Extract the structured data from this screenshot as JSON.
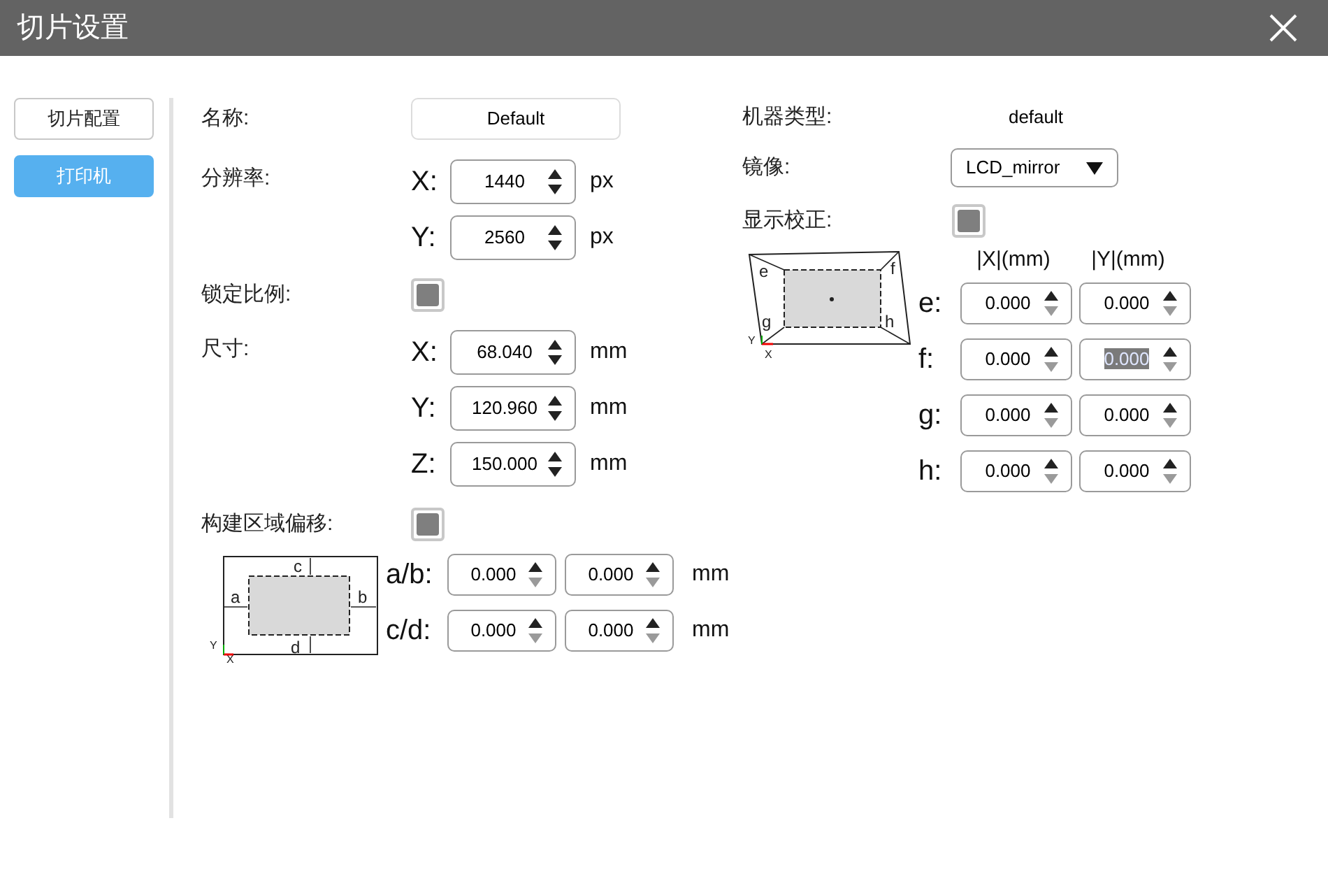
{
  "window": {
    "title": "切片设置"
  },
  "sidebar": {
    "items": [
      {
        "label": "切片配置",
        "selected": false
      },
      {
        "label": "打印机",
        "selected": true
      }
    ]
  },
  "name": {
    "label": "名称:",
    "value": "Default"
  },
  "resolution": {
    "label": "分辨率:",
    "axes": [
      {
        "axis": "X:",
        "value": "1440",
        "unit": "px",
        "at_min": false
      },
      {
        "axis": "Y:",
        "value": "2560",
        "unit": "px",
        "at_min": false
      }
    ]
  },
  "lock_ratio": {
    "label": "锁定比例:",
    "checked": false
  },
  "size": {
    "label": "尺寸:",
    "axes": [
      {
        "axis": "X:",
        "value": "68.040",
        "unit": "mm",
        "at_min": false
      },
      {
        "axis": "Y:",
        "value": "120.960",
        "unit": "mm",
        "at_min": false
      },
      {
        "axis": "Z:",
        "value": "150.000",
        "unit": "mm",
        "at_min": false
      }
    ]
  },
  "build_offset": {
    "label": "构建区域偏移:",
    "checked": false,
    "diagram_labels": [
      "c",
      "a",
      "b",
      "Y",
      "d",
      "X"
    ],
    "rows": [
      {
        "label": "a/b:",
        "unit": "mm",
        "fields": [
          {
            "value": "0.000",
            "at_min": true
          },
          {
            "value": "0.000",
            "at_min": true
          }
        ]
      },
      {
        "label": "c/d:",
        "unit": "mm",
        "fields": [
          {
            "value": "0.000",
            "at_min": true
          },
          {
            "value": "0.000",
            "at_min": true
          }
        ]
      }
    ]
  },
  "machine_type": {
    "label": "机器类型:",
    "value": "default"
  },
  "mirror": {
    "label": "镜像:",
    "value": "LCD_mirror"
  },
  "calibration": {
    "label": "显示校正:",
    "checked": false,
    "diagram_labels": [
      "e",
      "f",
      "g",
      "h",
      "Y",
      "X"
    ],
    "columns": [
      "|X|(mm)",
      "|Y|(mm)"
    ],
    "rows": [
      {
        "label": "e:",
        "fields": [
          {
            "value": "0.000",
            "at_min": true,
            "selected": false
          },
          {
            "value": "0.000",
            "at_min": true,
            "selected": false
          }
        ]
      },
      {
        "label": "f:",
        "fields": [
          {
            "value": "0.000",
            "at_min": true,
            "selected": false
          },
          {
            "value": "0.000",
            "at_min": true,
            "selected": true
          }
        ]
      },
      {
        "label": "g:",
        "fields": [
          {
            "value": "0.000",
            "at_min": true,
            "selected": false
          },
          {
            "value": "0.000",
            "at_min": true,
            "selected": false
          }
        ]
      },
      {
        "label": "h:",
        "fields": [
          {
            "value": "0.000",
            "at_min": true,
            "selected": false
          },
          {
            "value": "0.000",
            "at_min": true,
            "selected": false
          }
        ]
      }
    ]
  }
}
